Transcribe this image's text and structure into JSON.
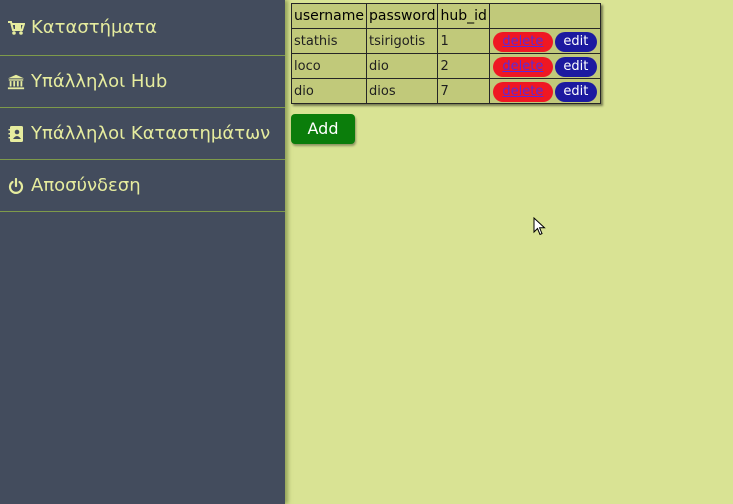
{
  "sidebar": {
    "items": [
      {
        "label": "Καταστήματα",
        "icon": "cart-icon"
      },
      {
        "label": "Υπάλληλοι Hub",
        "icon": "bank-icon"
      },
      {
        "label": "Υπάλληλοι Καταστημάτων",
        "icon": "contacts-book-icon"
      },
      {
        "label": "Αποσύνδεση",
        "icon": "power-icon"
      }
    ]
  },
  "table": {
    "headers": [
      "username",
      "password",
      "hub_id",
      ""
    ],
    "rows": [
      {
        "username": "stathis",
        "password": "tsirigotis",
        "hub_id": "1",
        "delete": "delete",
        "edit": "edit"
      },
      {
        "username": "loco",
        "password": "dio",
        "hub_id": "2",
        "delete": "delete",
        "edit": "edit"
      },
      {
        "username": "dio",
        "password": "dios",
        "hub_id": "7",
        "delete": "delete",
        "edit": "edit"
      }
    ]
  },
  "add_button": {
    "label": "Add"
  },
  "colors": {
    "page_bg": "#d9e394",
    "sidebar_bg": "#434c5d",
    "sidebar_text": "#e6ec9e",
    "table_bg": "#c1c97a",
    "delete_button": "#ef1723",
    "edit_button": "#1c1aa0",
    "add_button": "#0b7d0b"
  }
}
